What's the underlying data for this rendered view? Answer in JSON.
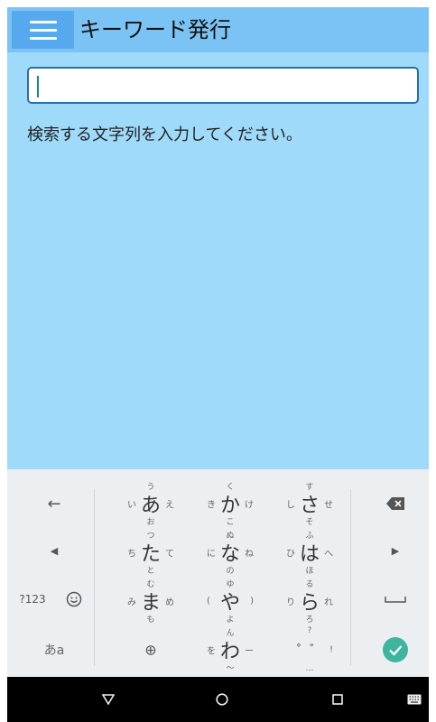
{
  "app": {
    "title": "キーワード発行",
    "menu_icon": "hamburger-menu-icon",
    "search": {
      "value": "",
      "placeholder": ""
    },
    "hint": "検索する文字列を入力してください。",
    "colors": {
      "appbar": "#7cc3f5",
      "menu_button": "#56a9ee",
      "content": "#9fdafa",
      "input_border": "#2e6da4"
    }
  },
  "keyboard": {
    "left_keys": {
      "undo": "←",
      "cursor_left": "◀",
      "mode_123": "?123",
      "emoji_icon": "smiley-icon",
      "kana_mode": "あa"
    },
    "right_keys": {
      "backspace_icon": "backspace-icon",
      "cursor_right": "▶",
      "space_icon": "space-icon",
      "enter_icon": "check-icon"
    },
    "rows": [
      [
        {
          "center": "あ",
          "top": "う",
          "bottom": "お",
          "left": "い",
          "right": "え"
        },
        {
          "center": "か",
          "top": "く",
          "bottom": "こ",
          "left": "き",
          "right": "け"
        },
        {
          "center": "さ",
          "top": "す",
          "bottom": "そ",
          "left": "し",
          "right": "せ"
        }
      ],
      [
        {
          "center": "た",
          "top": "つ",
          "bottom": "と",
          "left": "ち",
          "right": "て"
        },
        {
          "center": "な",
          "top": "ぬ",
          "bottom": "の",
          "left": "に",
          "right": "ね"
        },
        {
          "center": "は",
          "top": "ふ",
          "bottom": "ほ",
          "left": "ひ",
          "right": "へ"
        }
      ],
      [
        {
          "center": "ま",
          "top": "む",
          "bottom": "も",
          "left": "み",
          "right": "め"
        },
        {
          "center": "や",
          "top": "ゆ",
          "bottom": "よ",
          "left": "(",
          "right": ")"
        },
        {
          "center": "ら",
          "top": "る",
          "bottom": "ろ",
          "left": "り",
          "right": "れ"
        }
      ],
      [
        {
          "center": "⊕",
          "top": "",
          "bottom": "",
          "left": "",
          "right": ""
        },
        {
          "center": "わ",
          "top": "ん",
          "bottom": "〜",
          "left": "を",
          "right": "ー"
        },
        {
          "center": "゜゛",
          "top": "?",
          "bottom": "…",
          "left": "",
          "right": "!"
        }
      ]
    ],
    "globe_icon": "globe-icon"
  },
  "navbar": {
    "back_icon": "back-triangle-icon",
    "home_icon": "home-circle-icon",
    "recents_icon": "recents-square-icon",
    "keyboard_icon": "keyboard-icon"
  }
}
